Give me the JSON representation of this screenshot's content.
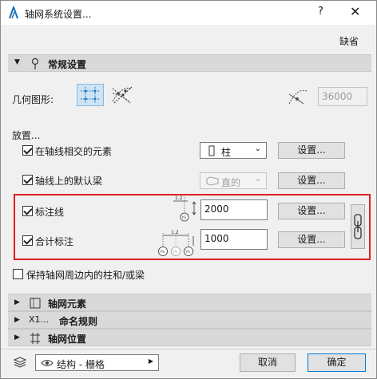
{
  "window": {
    "title": "轴网系统设置...",
    "help_label": "?",
    "close_label": "✕",
    "defaults_label": "缺省"
  },
  "general": {
    "header": "常规设置",
    "geometry_label": "几何图形:",
    "radius_value": "36000",
    "placement_label": "放置...",
    "column_label": "在轴线相交的元素",
    "column_select": "柱",
    "column_settings": "设置...",
    "beam_label": "轴线上的默认梁",
    "beam_select": "直的",
    "beam_settings": "设置...",
    "dim_label": "标注线",
    "dim_value": "2000",
    "dim_settings": "设置...",
    "total_dim_label": "合计标注",
    "total_dim_value": "1000",
    "total_dim_settings": "设置...",
    "dim_icon_text": "1.2",
    "dim_icon_ys": "YS",
    "perimeter_label": "保持轴网周边内的柱和/或梁"
  },
  "states": {
    "column_checked": true,
    "beam_checked": true,
    "dim_checked": true,
    "total_dim_checked": true,
    "perimeter_checked": false
  },
  "sections": [
    {
      "label": "轴网元素",
      "prefix": ""
    },
    {
      "label": "命名规则",
      "prefix": "X1..."
    },
    {
      "label": "轴网位置",
      "prefix": ""
    }
  ],
  "footer": {
    "layer_select": "结构 - 栅格",
    "cancel_label": "取消",
    "ok_label": "确定"
  },
  "colors": {
    "highlight_border": "#e02020",
    "selected_tool_bg": "#cde4f7",
    "accent": "#0078d7"
  }
}
